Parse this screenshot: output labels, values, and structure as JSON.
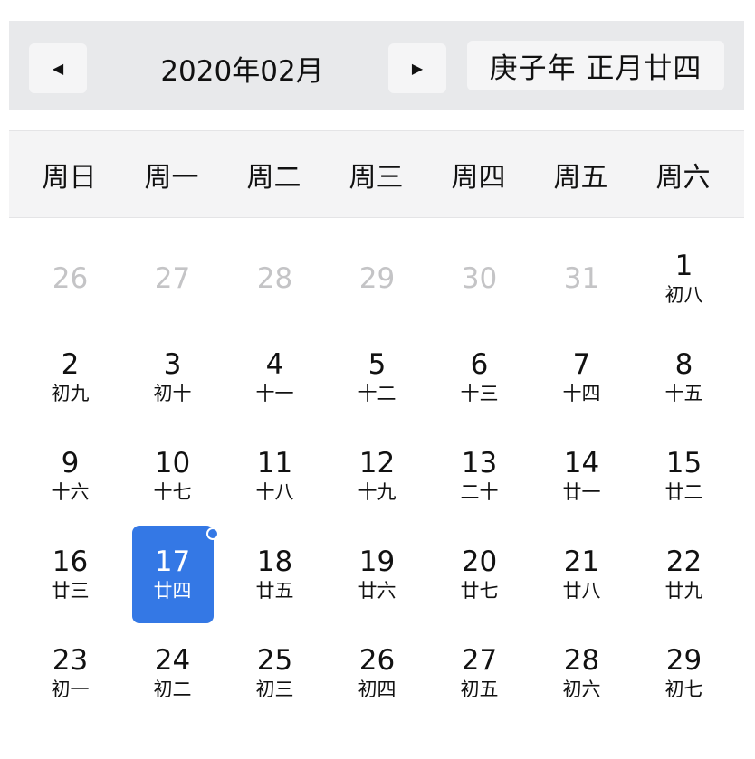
{
  "header": {
    "prev_label": "◀",
    "next_label": "▶",
    "month_title": "2020年02月",
    "lunar_badge": "庚子年 正月廿四"
  },
  "weekdays": [
    "周日",
    "周一",
    "周二",
    "周三",
    "周四",
    "周五",
    "周六"
  ],
  "colors": {
    "accent": "#3478e5",
    "muted": "#c4c4c6",
    "header_bg": "#e8e9eb"
  },
  "days": [
    {
      "day": "26",
      "lunar": "",
      "other": true
    },
    {
      "day": "27",
      "lunar": "",
      "other": true
    },
    {
      "day": "28",
      "lunar": "",
      "other": true
    },
    {
      "day": "29",
      "lunar": "",
      "other": true
    },
    {
      "day": "30",
      "lunar": "",
      "other": true
    },
    {
      "day": "31",
      "lunar": "",
      "other": true
    },
    {
      "day": "1",
      "lunar": "初八"
    },
    {
      "day": "2",
      "lunar": "初九"
    },
    {
      "day": "3",
      "lunar": "初十"
    },
    {
      "day": "4",
      "lunar": "十一"
    },
    {
      "day": "5",
      "lunar": "十二"
    },
    {
      "day": "6",
      "lunar": "十三"
    },
    {
      "day": "7",
      "lunar": "十四"
    },
    {
      "day": "8",
      "lunar": "十五"
    },
    {
      "day": "9",
      "lunar": "十六"
    },
    {
      "day": "10",
      "lunar": "十七"
    },
    {
      "day": "11",
      "lunar": "十八"
    },
    {
      "day": "12",
      "lunar": "十九"
    },
    {
      "day": "13",
      "lunar": "二十"
    },
    {
      "day": "14",
      "lunar": "廿一"
    },
    {
      "day": "15",
      "lunar": "廿二"
    },
    {
      "day": "16",
      "lunar": "廿三"
    },
    {
      "day": "17",
      "lunar": "廿四",
      "selected": true,
      "has_event": true
    },
    {
      "day": "18",
      "lunar": "廿五"
    },
    {
      "day": "19",
      "lunar": "廿六"
    },
    {
      "day": "20",
      "lunar": "廿七"
    },
    {
      "day": "21",
      "lunar": "廿八"
    },
    {
      "day": "22",
      "lunar": "廿九"
    },
    {
      "day": "23",
      "lunar": "初一"
    },
    {
      "day": "24",
      "lunar": "初二"
    },
    {
      "day": "25",
      "lunar": "初三"
    },
    {
      "day": "26",
      "lunar": "初四"
    },
    {
      "day": "27",
      "lunar": "初五"
    },
    {
      "day": "28",
      "lunar": "初六"
    },
    {
      "day": "29",
      "lunar": "初七"
    }
  ]
}
